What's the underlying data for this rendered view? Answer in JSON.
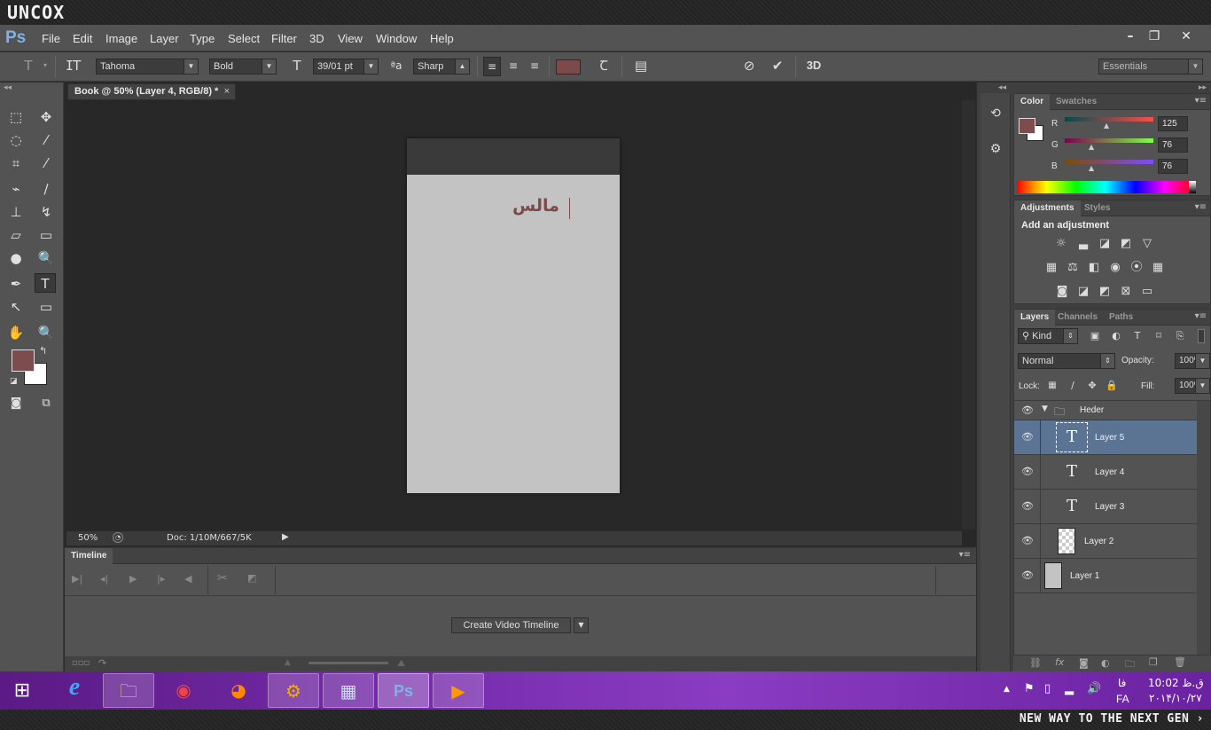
{
  "brand": {
    "logo": "UNCOX",
    "slogan": "NEW WAY TO THE NEXT GEN ›"
  },
  "app": {
    "logo": "Ps"
  },
  "menu": [
    "File",
    "Edit",
    "Image",
    "Layer",
    "Type",
    "Select",
    "Filter",
    "3D",
    "View",
    "Window",
    "Help"
  ],
  "options": {
    "font_family": "Tahoma",
    "font_style": "Bold",
    "font_size": "39/01 pt",
    "aa_label": "ªa",
    "antialias": "Sharp",
    "workspace": "Essentials",
    "three_d": "3D",
    "text_color": "#7d4a4a"
  },
  "document": {
    "tab_title": "Book @ 50% (Layer 4, RGB/8) *",
    "text": "مالس",
    "zoom": "50%",
    "doc_info": "Doc: 1/10M/667/5K"
  },
  "timeline": {
    "tab": "Timeline",
    "create_button": "Create Video Timeline"
  },
  "color_panel": {
    "tabs": [
      "Color",
      "Swatches"
    ],
    "r_label": "R",
    "g_label": "G",
    "b_label": "B",
    "r": "125",
    "g": "76",
    "b": "76",
    "fg": "#7d4c4c",
    "bg": "#ffffff"
  },
  "adjust_panel": {
    "tabs": [
      "Adjustments",
      "Styles"
    ],
    "heading": "Add an adjustment"
  },
  "layers_panel": {
    "tabs": [
      "Layers",
      "Channels",
      "Paths"
    ],
    "kind": "Kind",
    "blend": "Normal",
    "opacity_label": "Opacity:",
    "opacity": "100%",
    "lock_label": "Lock:",
    "fill_label": "Fill:",
    "fill": "100%",
    "group": "Heder",
    "layers": [
      {
        "name": "Layer 5",
        "type": "text"
      },
      {
        "name": "Layer 4",
        "type": "text"
      },
      {
        "name": "Layer 3",
        "type": "text"
      },
      {
        "name": "Layer 2",
        "type": "pixel"
      },
      {
        "name": "Layer 1",
        "type": "fill"
      }
    ]
  },
  "taskbar": {
    "lang": "FA",
    "lang_short": "فا",
    "time": "10:02 ق.ظ",
    "date": "۲۰۱۴/۱۰/۲۷"
  }
}
